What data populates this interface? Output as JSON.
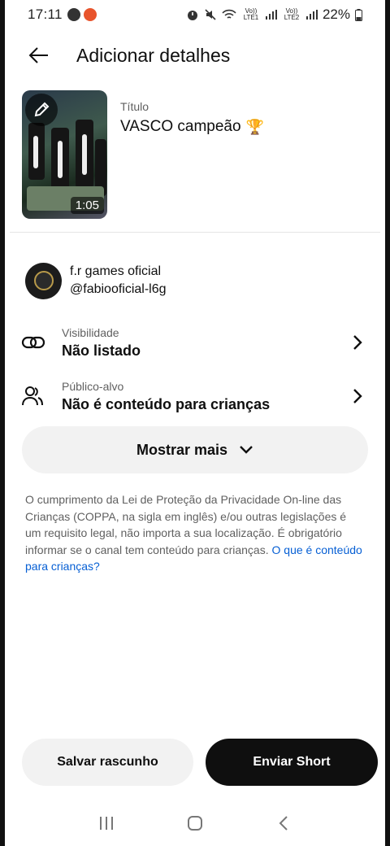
{
  "status_bar": {
    "time": "17:11",
    "network_1": "Vo)) LTE1",
    "network_2": "Vo)) LTE2",
    "battery": "22%"
  },
  "header": {
    "title": "Adicionar detalhes",
    "back_icon": "arrow-left-icon"
  },
  "video": {
    "duration": "1:05",
    "title_label": "Título",
    "title_value": "VASCO campeão",
    "title_emoji": "🏆",
    "edit_icon": "pencil-icon"
  },
  "channel": {
    "name": "f.r games oficial",
    "handle": "@fabiooficial-l6g"
  },
  "visibility": {
    "label": "Visibilidade",
    "value": "Não listado",
    "icon": "link-icon"
  },
  "audience": {
    "label": "Público-alvo",
    "value": "Não é conteúdo para crianças",
    "icon": "people-icon"
  },
  "show_more": {
    "label": "Mostrar mais"
  },
  "coppa": {
    "text": "O cumprimento da Lei de Proteção da Privacidade On-line das Crianças (COPPA, na sigla em inglês) e/ou outras legislações é um requisito legal, não importa a sua localização. É obrigatório informar se o canal tem conteúdo para crianças. ",
    "link": "O que é conteúdo para crianças?"
  },
  "actions": {
    "draft": "Salvar rascunho",
    "send": "Enviar Short"
  },
  "colors": {
    "link": "#065fd4",
    "primary_button": "#0f0f0f",
    "secondary_button": "#f2f2f2"
  }
}
